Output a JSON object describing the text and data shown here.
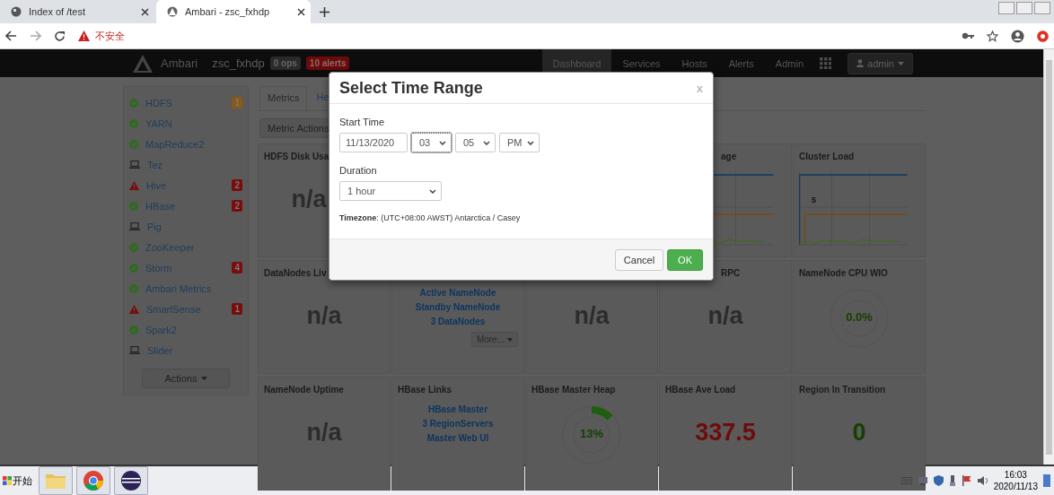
{
  "browser": {
    "tabs": [
      {
        "title": "Index of /test",
        "selected": false
      },
      {
        "title": "Ambari - zsc_fxhdp",
        "selected": true
      }
    ],
    "security_label": "不安全"
  },
  "navbar": {
    "brand": "Ambari",
    "cluster": "zsc_fxhdp",
    "ops_badge": "0 ops",
    "alerts_badge": "10 alerts",
    "items": [
      {
        "label": "Dashboard",
        "selected": true
      },
      {
        "label": "Services",
        "selected": false
      },
      {
        "label": "Hosts",
        "selected": false
      },
      {
        "label": "Alerts",
        "selected": false
      },
      {
        "label": "Admin",
        "selected": false
      }
    ],
    "user": "admin"
  },
  "sidebar": {
    "services": [
      {
        "name": "HDFS",
        "kind": "ok",
        "alerts": "1",
        "color": "#8a5a14"
      },
      {
        "name": "YARN",
        "kind": "ok"
      },
      {
        "name": "MapReduce2",
        "kind": "ok"
      },
      {
        "name": "Tez",
        "kind": "client"
      },
      {
        "name": "Hive",
        "kind": "warn",
        "alerts": "2",
        "color": "#7a0c0c"
      },
      {
        "name": "HBase",
        "kind": "ok",
        "alerts": "2",
        "color": "#7a0c0c"
      },
      {
        "name": "Pig",
        "kind": "client"
      },
      {
        "name": "ZooKeeper",
        "kind": "ok"
      },
      {
        "name": "Storm",
        "kind": "ok",
        "alerts": "4",
        "color": "#7a0c0c"
      },
      {
        "name": "Ambari Metrics",
        "kind": "ok"
      },
      {
        "name": "SmartSense",
        "kind": "warn",
        "alerts": "1",
        "color": "#7a0c0c"
      },
      {
        "name": "Spark2",
        "kind": "ok"
      },
      {
        "name": "Slider",
        "kind": "client"
      }
    ],
    "actions": "Actions"
  },
  "dashboard": {
    "tabs": [
      {
        "label": "Metrics",
        "selected": true
      },
      {
        "label": "He",
        "selected": false
      }
    ],
    "metric_actions": "Metric Actions",
    "widgets": [
      {
        "kind": "value",
        "title": "HDFS Disk Usa",
        "value": "n/a",
        "color": "#2c2c2c"
      },
      {
        "kind": "chart",
        "title": "age"
      },
      {
        "kind": "chart",
        "title": "Cluster Load",
        "tick": "5"
      },
      {
        "kind": "value",
        "title": "DataNodes Liv",
        "value": "n/a",
        "color": "#2c2c2c"
      },
      {
        "kind": "links",
        "links": [
          "Active NameNode",
          "Standby NameNode",
          "3 DataNodes"
        ],
        "more": "More..."
      },
      {
        "kind": "value",
        "value": "n/a",
        "color": "#2c2c2c"
      },
      {
        "kind": "value",
        "title": "RPC",
        "value": "n/a",
        "color": "#2c2c2c"
      },
      {
        "kind": "donut",
        "title": "NameNode CPU WIO",
        "reading": "0.0%"
      },
      {
        "kind": "value",
        "title": "NameNode Uptime",
        "value": "n/a",
        "color": "#2c2c2c"
      },
      {
        "kind": "links",
        "title": "HBase Links",
        "links": [
          "HBase Master",
          "3 RegionServers",
          "Master Web UI"
        ]
      },
      {
        "kind": "donut",
        "title": "HBase Master Heap",
        "reading": "13%",
        "level": 0.13
      },
      {
        "kind": "value",
        "title": "HBase Ave Load",
        "value": "337.5",
        "color": "#6e0b0b"
      },
      {
        "kind": "value",
        "title": "Region In Transition",
        "value": "0",
        "color": "#143f00"
      }
    ]
  },
  "modal": {
    "title": "Select Time Range",
    "close": "x",
    "start_label": "Start Time",
    "date": "11/13/2020",
    "selects": [
      {
        "value": "03",
        "focused": true
      },
      {
        "value": "05",
        "focused": false
      },
      {
        "value": "PM",
        "focused": false
      }
    ],
    "duration_label": "Duration",
    "duration": "1 hour",
    "timezone_label": "Timezone",
    "timezone": ": (UTC+08:00 AWST) Antarctica / Casey",
    "cancel": "Cancel",
    "ok": "OK"
  },
  "taskbar": {
    "start": "开始",
    "time": "16:03",
    "date": "2020/11/13"
  }
}
